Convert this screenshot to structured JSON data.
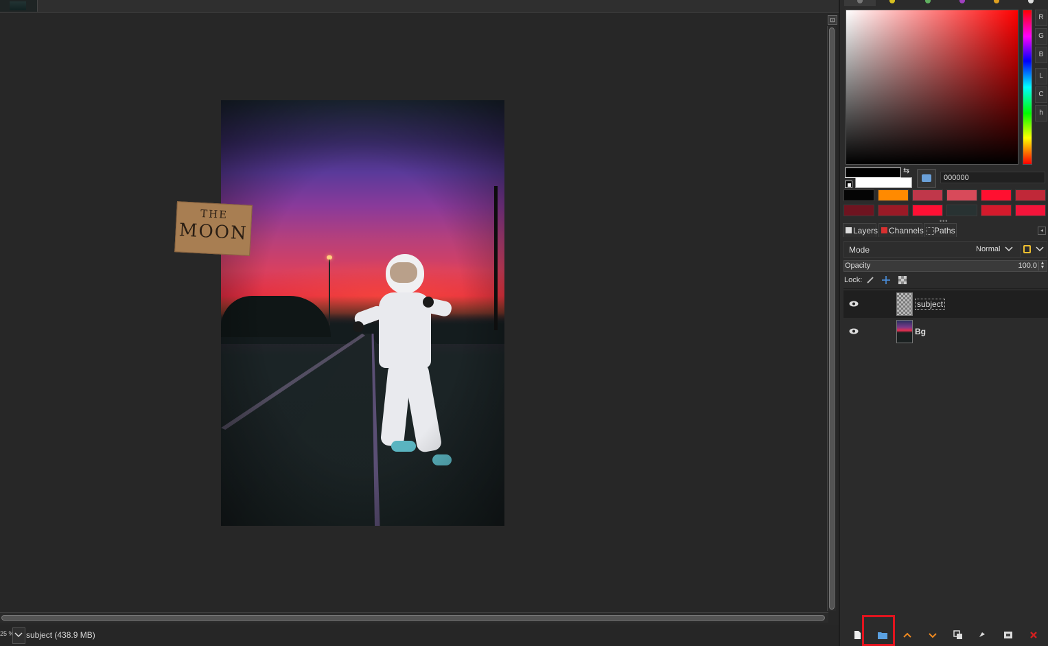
{
  "statusbar": {
    "zoom": "25 %",
    "info": "subject (438.9 MB)"
  },
  "canvas": {
    "sign_line1": "THE",
    "sign_line2": "MOON"
  },
  "color_panel": {
    "channel_buttons": [
      "R",
      "G",
      "B",
      "L",
      "C",
      "h"
    ],
    "hex_value": "000000",
    "foreground": "#000000",
    "background": "#ffffff",
    "history": [
      "#050505",
      "#ff8a00",
      "#c0374a",
      "#d84a5a",
      "#ff1030",
      "#c02838",
      "#6e1420",
      "#9a1a26",
      "#ff1034",
      "#283232",
      "#d41a2c",
      "#f4143a"
    ]
  },
  "dock_tabs": [
    "Layers",
    "Channels",
    "Paths"
  ],
  "layers_panel": {
    "mode_label": "Mode",
    "mode_value": "Normal",
    "opacity_label": "Opacity",
    "opacity_value": "100.0",
    "lock_label": "Lock:",
    "layers": [
      {
        "name": "subject",
        "visible": true,
        "selected": true
      },
      {
        "name": "Bg",
        "visible": true,
        "selected": false
      }
    ]
  },
  "colors": {
    "highlight": "#e2141e",
    "panel_bg": "#2b2b2b",
    "canvas_bg": "#272727"
  }
}
